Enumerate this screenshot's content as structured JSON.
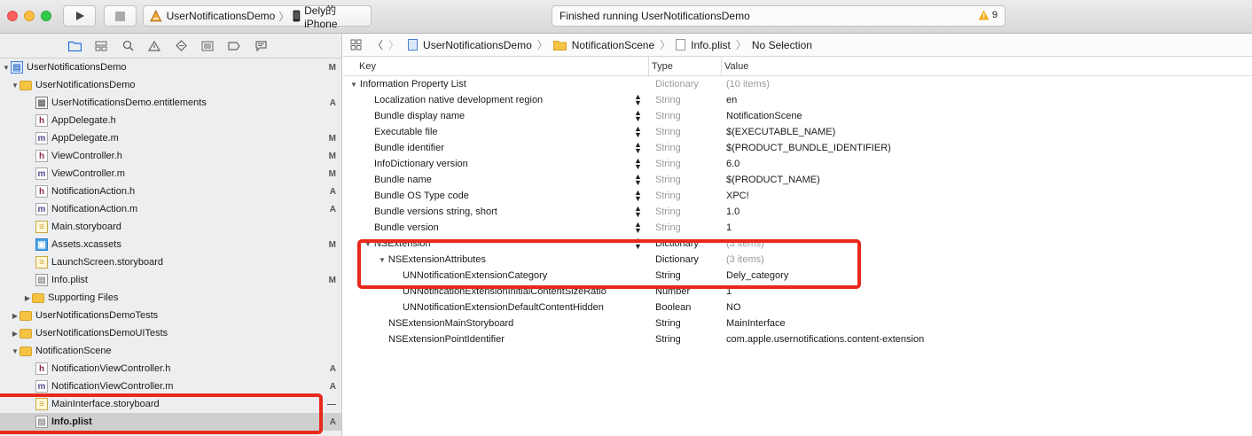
{
  "toolbar": {
    "scheme_name": "UserNotificationsDemo",
    "device_name": "Dely的 iPhone",
    "status_text": "Finished running UserNotificationsDemo",
    "warning_count": "9"
  },
  "navigator": {
    "rows": [
      {
        "label": "UserNotificationsDemo",
        "status": "M"
      },
      {
        "label": "UserNotificationsDemo",
        "status": ""
      },
      {
        "label": "UserNotificationsDemo.entitlements",
        "status": "A"
      },
      {
        "label": "AppDelegate.h",
        "status": ""
      },
      {
        "label": "AppDelegate.m",
        "status": "M"
      },
      {
        "label": "ViewController.h",
        "status": "M"
      },
      {
        "label": "ViewController.m",
        "status": "M"
      },
      {
        "label": "NotificationAction.h",
        "status": "A"
      },
      {
        "label": "NotificationAction.m",
        "status": "A"
      },
      {
        "label": "Main.storyboard",
        "status": ""
      },
      {
        "label": "Assets.xcassets",
        "status": "M"
      },
      {
        "label": "LaunchScreen.storyboard",
        "status": ""
      },
      {
        "label": "Info.plist",
        "status": "M"
      },
      {
        "label": "Supporting Files",
        "status": ""
      },
      {
        "label": "UserNotificationsDemoTests",
        "status": ""
      },
      {
        "label": "UserNotificationsDemoUITests",
        "status": ""
      },
      {
        "label": "NotificationScene",
        "status": ""
      },
      {
        "label": "NotificationViewController.h",
        "status": "A"
      },
      {
        "label": "NotificationViewController.m",
        "status": "A"
      },
      {
        "label": "MainInterface.storyboard",
        "status": "—"
      },
      {
        "label": "Info.plist",
        "status": "A"
      }
    ]
  },
  "jumpbar": {
    "project": "UserNotificationsDemo",
    "group": "NotificationScene",
    "file": "Info.plist",
    "selection": "No Selection"
  },
  "plist": {
    "headers": {
      "key": "Key",
      "type": "Type",
      "value": "Value"
    },
    "rows": [
      {
        "key": "Information Property List",
        "type": "Dictionary",
        "value": "(10 items)"
      },
      {
        "key": "Localization native development region",
        "type": "String",
        "value": "en"
      },
      {
        "key": "Bundle display name",
        "type": "String",
        "value": "NotificationScene"
      },
      {
        "key": "Executable file",
        "type": "String",
        "value": "$(EXECUTABLE_NAME)"
      },
      {
        "key": "Bundle identifier",
        "type": "String",
        "value": "$(PRODUCT_BUNDLE_IDENTIFIER)"
      },
      {
        "key": "InfoDictionary version",
        "type": "String",
        "value": "6.0"
      },
      {
        "key": "Bundle name",
        "type": "String",
        "value": "$(PRODUCT_NAME)"
      },
      {
        "key": "Bundle OS Type code",
        "type": "String",
        "value": "XPC!"
      },
      {
        "key": "Bundle versions string, short",
        "type": "String",
        "value": "1.0"
      },
      {
        "key": "Bundle version",
        "type": "String",
        "value": "1"
      },
      {
        "key": "NSExtension",
        "type": "Dictionary",
        "value": "(3 items)"
      },
      {
        "key": "NSExtensionAttributes",
        "type": "Dictionary",
        "value": "(3 items)"
      },
      {
        "key": "UNNotificationExtensionCategory",
        "type": "String",
        "value": "Dely_category"
      },
      {
        "key": "UNNotificationExtensionInitialContentSizeRatio",
        "type": "Number",
        "value": "1"
      },
      {
        "key": "UNNotificationExtensionDefaultContentHidden",
        "type": "Boolean",
        "value": "NO"
      },
      {
        "key": "NSExtensionMainStoryboard",
        "type": "String",
        "value": "MainInterface"
      },
      {
        "key": "NSExtensionPointIdentifier",
        "type": "String",
        "value": "com.apple.usernotifications.content-extension"
      }
    ]
  }
}
